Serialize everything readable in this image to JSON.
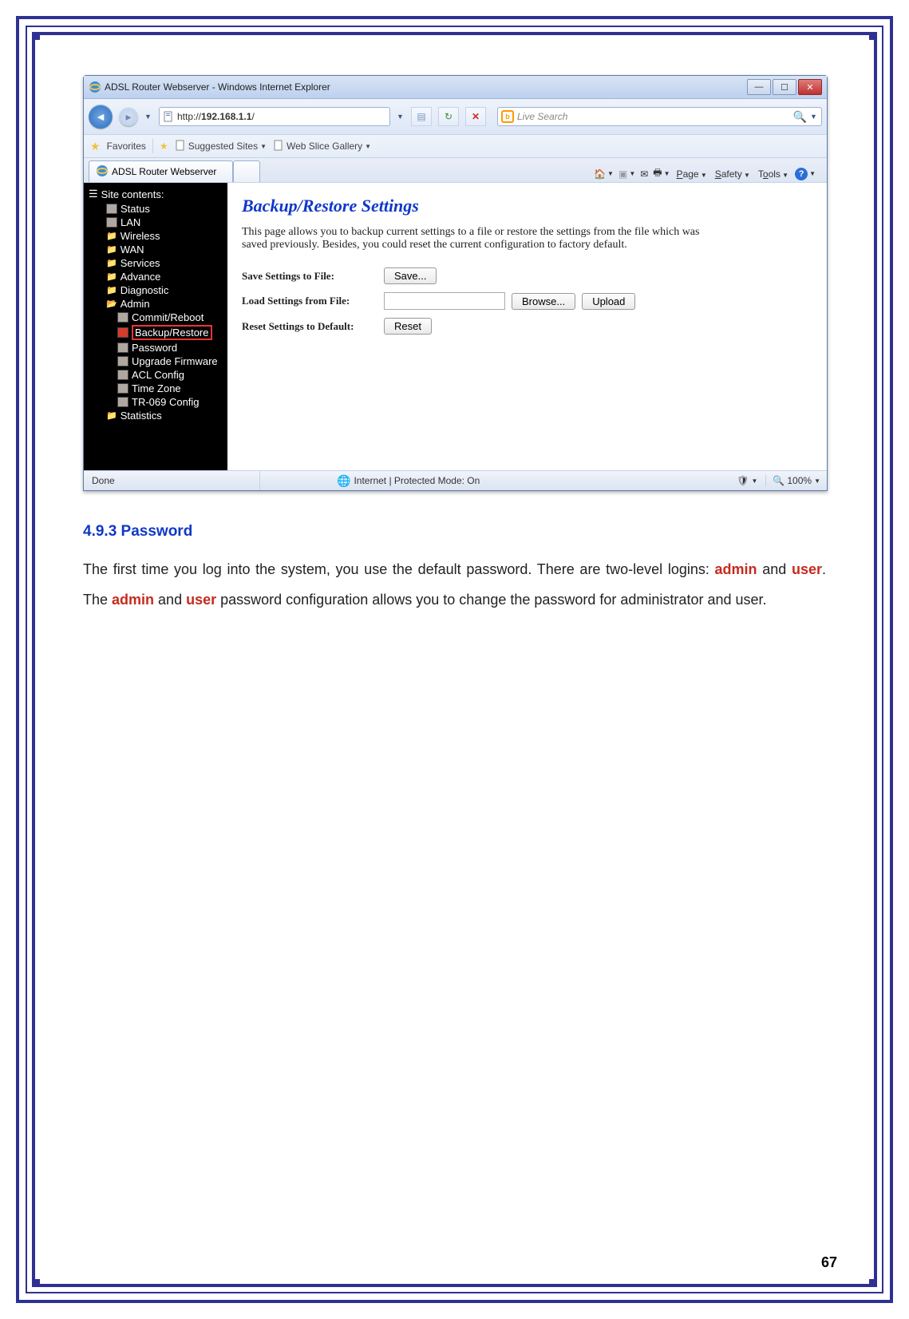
{
  "browser": {
    "window_title": "ADSL Router Webserver - Windows Internet Explorer",
    "url_prefix": "http://",
    "url_host": "192.168.1.1",
    "url_suffix": "/",
    "refresh_tip": "Refresh",
    "stop_tip": "Stop",
    "search_placeholder": "Live Search",
    "favorites_label": "Favorites",
    "suggested_sites": "Suggested Sites",
    "web_slice": "Web Slice Gallery",
    "tab_title": "ADSL Router Webserver",
    "cmd_page": "Page",
    "cmd_safety": "Safety",
    "cmd_tools": "Tools",
    "status_done": "Done",
    "status_zone": "Internet | Protected Mode: On",
    "zoom": "100%"
  },
  "sidebar": {
    "heading": "Site contents:",
    "items": {
      "status": "Status",
      "lan": "LAN",
      "wireless": "Wireless",
      "wan": "WAN",
      "services": "Services",
      "advance": "Advance",
      "diagnostic": "Diagnostic",
      "admin": "Admin",
      "admin_children": {
        "commit": "Commit/Reboot",
        "backup": "Backup/Restore",
        "password": "Password",
        "upgrade": "Upgrade Firmware",
        "acl": "ACL Config",
        "timezone": "Time Zone",
        "tr069": "TR-069 Config"
      },
      "statistics": "Statistics"
    }
  },
  "panel": {
    "title": "Backup/Restore Settings",
    "desc": "This page allows you to backup current settings to a file or restore the settings from the file which was saved previously. Besides, you could reset the current configuration to factory default.",
    "save_label": "Save Settings to File:",
    "save_btn": "Save...",
    "load_label": "Load Settings from File:",
    "browse_btn": "Browse...",
    "upload_btn": "Upload",
    "reset_label": "Reset Settings to Default:",
    "reset_btn": "Reset"
  },
  "doc": {
    "heading": "4.9.3 Password",
    "p1a": "The first time you log into the system, you use the default password. There are two-level logins: ",
    "p1_admin": "admin",
    "p1_and": " and ",
    "p1_user": "user",
    "p1b": ". The ",
    "p1_admin2": "admin",
    "p1_and2": " and ",
    "p1_user2": "user",
    "p1c": " password configuration allows you to change the password for administrator and user."
  },
  "page_number": "67"
}
